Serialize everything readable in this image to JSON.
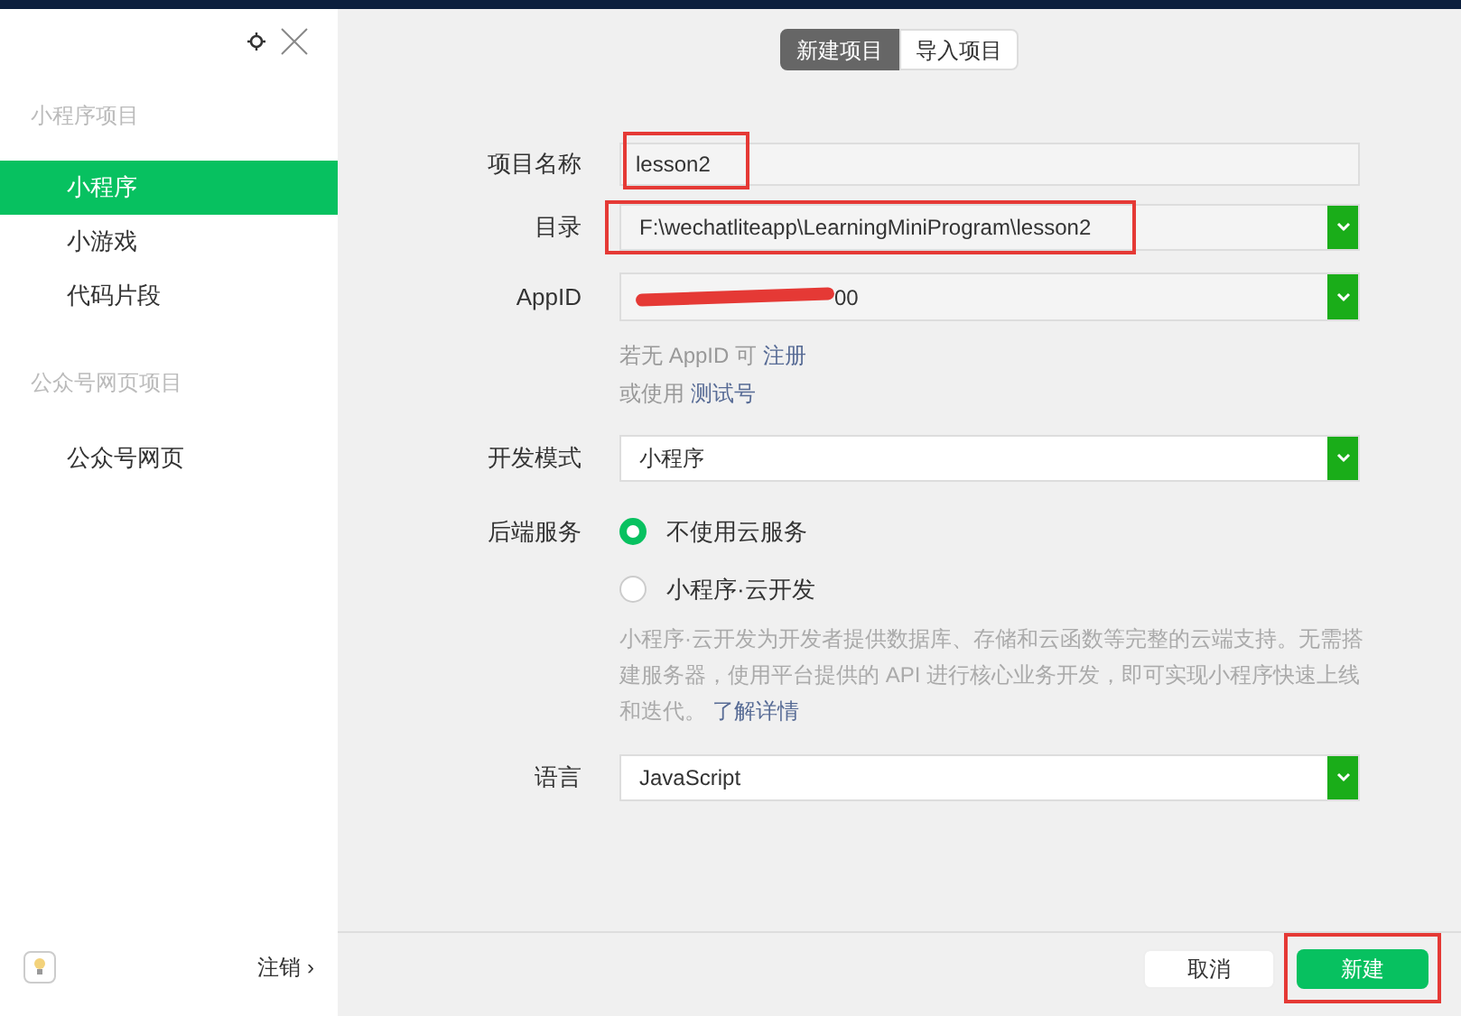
{
  "sidebar": {
    "sections": [
      {
        "title": "小程序项目",
        "items": [
          {
            "label": "小程序",
            "selected": true
          },
          {
            "label": "小游戏",
            "selected": false
          },
          {
            "label": "代码片段",
            "selected": false
          }
        ]
      },
      {
        "title": "公众号网页项目",
        "items": [
          {
            "label": "公众号网页",
            "selected": false
          }
        ]
      }
    ],
    "logout": "注销 ›"
  },
  "tabs": [
    {
      "label": "新建项目",
      "selected": true
    },
    {
      "label": "导入项目",
      "selected": false
    }
  ],
  "form": {
    "name": {
      "label": "项目名称",
      "value": "lesson2",
      "highlighted": true
    },
    "directory": {
      "label": "目录",
      "value": "F:\\wechatliteapp\\LearningMiniProgram\\lesson2",
      "highlighted": true
    },
    "appid": {
      "label": "AppID",
      "value": "00",
      "redacted": true,
      "hint_prefix": "若无 AppID 可",
      "hint_link": "注册",
      "alt_prefix": "或使用",
      "alt_link": "测试号"
    },
    "mode": {
      "label": "开发模式",
      "value": "小程序"
    },
    "backend": {
      "label": "后端服务",
      "options": [
        {
          "label": "不使用云服务",
          "selected": true
        },
        {
          "label": "小程序·云开发",
          "selected": false
        }
      ],
      "description": "小程序·云开发为开发者提供数据库、存储和云函数等完整的云端支持。无需搭建服务器，使用平台提供的 API 进行核心业务开发，即可实现小程序快速上线和迭代。",
      "more_link": "了解详情"
    },
    "language": {
      "label": "语言",
      "value": "JavaScript"
    }
  },
  "buttons": [
    {
      "label": "取消",
      "kind": "secondary",
      "highlighted": false
    },
    {
      "label": "新建",
      "kind": "primary",
      "highlighted": true
    }
  ]
}
